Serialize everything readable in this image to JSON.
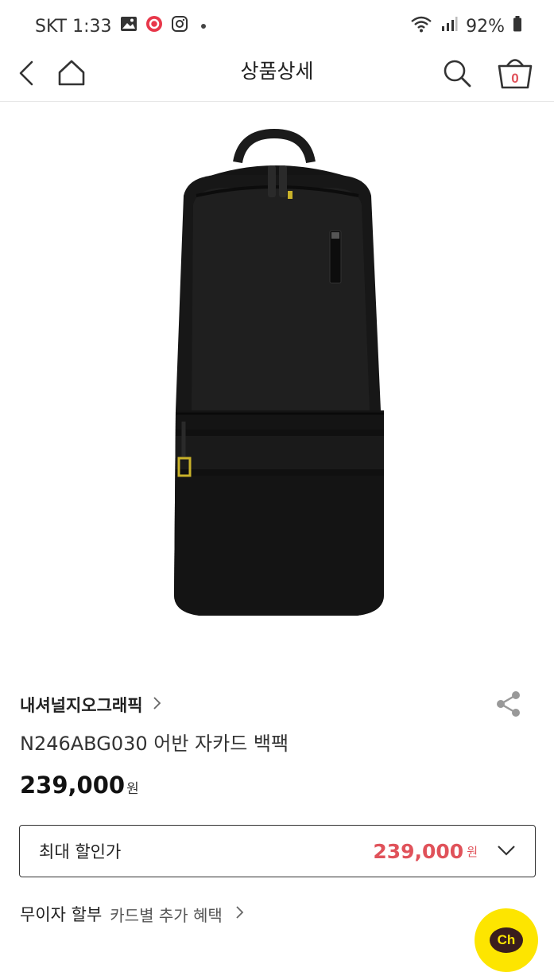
{
  "status_bar": {
    "carrier_time": "SKT 1:33",
    "battery": "92%"
  },
  "header": {
    "title": "상품상세",
    "cart_count": "0"
  },
  "product": {
    "brand": "내셔널지오그래픽",
    "name": "N246ABG030 어반 자카드 백팩",
    "price": "239,000",
    "currency": "원"
  },
  "max_discount": {
    "label": "최대 할인가",
    "price": "239,000",
    "currency": "원"
  },
  "installment": {
    "title": "무이자 할부",
    "subtitle": "카드별 추가 혜택"
  },
  "chat": {
    "label": "Ch"
  },
  "colors": {
    "accent_price": "#e0525a",
    "chat_yellow": "#fde500"
  }
}
